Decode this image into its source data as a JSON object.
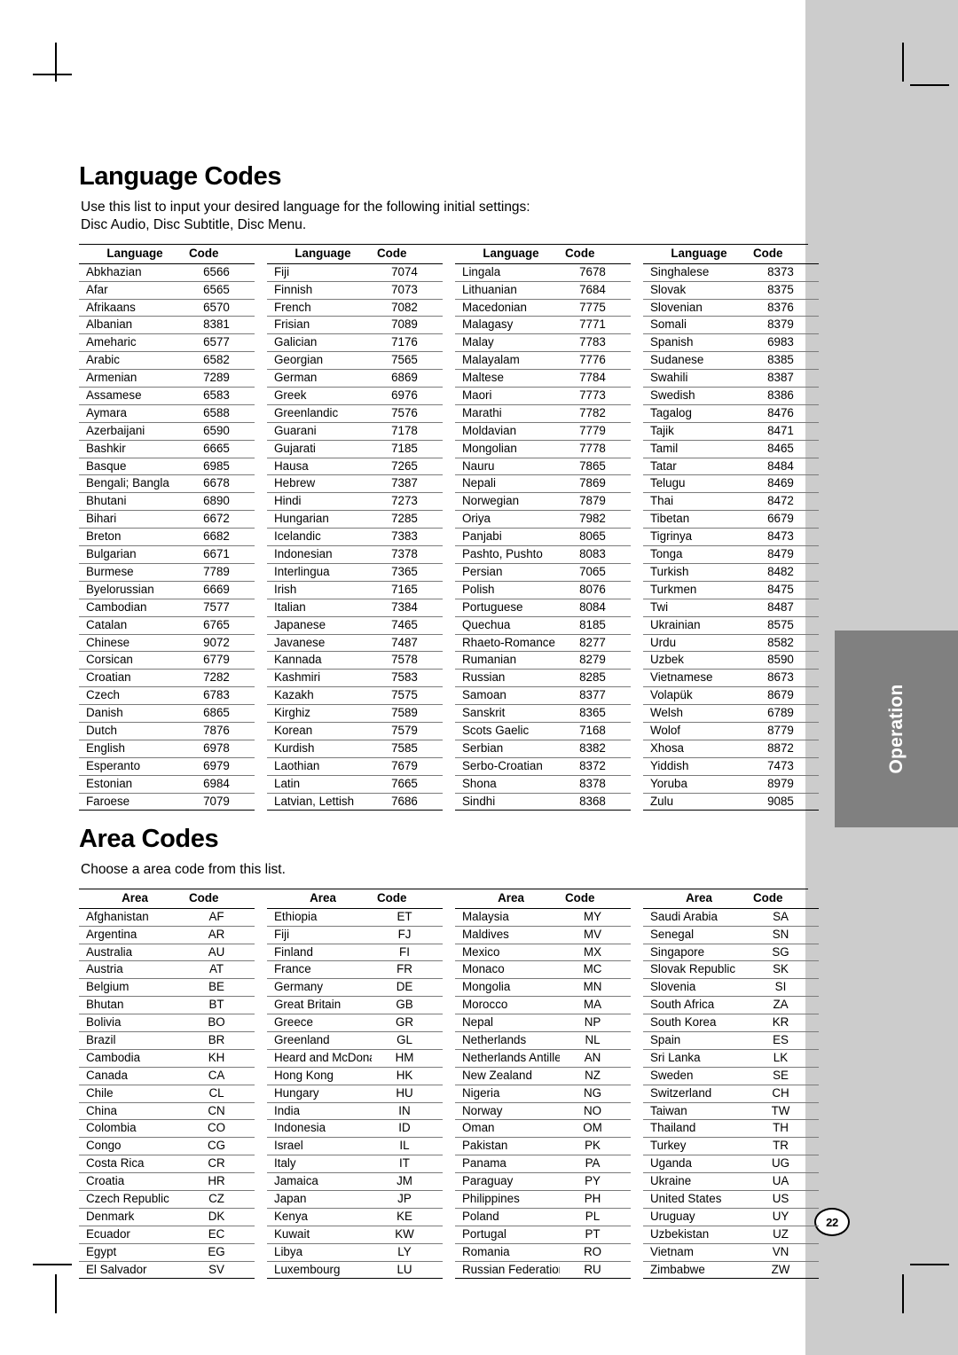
{
  "page": {
    "number": "22",
    "side_tab_label": "Operation"
  },
  "language_section": {
    "title": "Language Codes",
    "intro_line1": "Use this list to input your desired language for the following initial settings:",
    "intro_line2": "Disc Audio, Disc Subtitle, Disc Menu.",
    "headers": {
      "name": "Language",
      "code": "Code"
    },
    "columns": [
      [
        [
          "Abkhazian",
          "6566"
        ],
        [
          "Afar",
          "6565"
        ],
        [
          "Afrikaans",
          "6570"
        ],
        [
          "Albanian",
          "8381"
        ],
        [
          "Ameharic",
          "6577"
        ],
        [
          "Arabic",
          "6582"
        ],
        [
          "Armenian",
          "7289"
        ],
        [
          "Assamese",
          "6583"
        ],
        [
          "Aymara",
          "6588"
        ],
        [
          "Azerbaijani",
          "6590"
        ],
        [
          "Bashkir",
          "6665"
        ],
        [
          "Basque",
          "6985"
        ],
        [
          "Bengali; Bangla",
          "6678"
        ],
        [
          "Bhutani",
          "6890"
        ],
        [
          "Bihari",
          "6672"
        ],
        [
          "Breton",
          "6682"
        ],
        [
          "Bulgarian",
          "6671"
        ],
        [
          "Burmese",
          "7789"
        ],
        [
          "Byelorussian",
          "6669"
        ],
        [
          "Cambodian",
          "7577"
        ],
        [
          "Catalan",
          "6765"
        ],
        [
          "Chinese",
          "9072"
        ],
        [
          "Corsican",
          "6779"
        ],
        [
          "Croatian",
          "7282"
        ],
        [
          "Czech",
          "6783"
        ],
        [
          "Danish",
          "6865"
        ],
        [
          "Dutch",
          "7876"
        ],
        [
          "English",
          "6978"
        ],
        [
          "Esperanto",
          "6979"
        ],
        [
          "Estonian",
          "6984"
        ],
        [
          "Faroese",
          "7079"
        ]
      ],
      [
        [
          "Fiji",
          "7074"
        ],
        [
          "Finnish",
          "7073"
        ],
        [
          "French",
          "7082"
        ],
        [
          "Frisian",
          "7089"
        ],
        [
          "Galician",
          "7176"
        ],
        [
          "Georgian",
          "7565"
        ],
        [
          "German",
          "6869"
        ],
        [
          "Greek",
          "6976"
        ],
        [
          "Greenlandic",
          "7576"
        ],
        [
          "Guarani",
          "7178"
        ],
        [
          "Gujarati",
          "7185"
        ],
        [
          "Hausa",
          "7265"
        ],
        [
          "Hebrew",
          "7387"
        ],
        [
          "Hindi",
          "7273"
        ],
        [
          "Hungarian",
          "7285"
        ],
        [
          "Icelandic",
          "7383"
        ],
        [
          "Indonesian",
          "7378"
        ],
        [
          "Interlingua",
          "7365"
        ],
        [
          "Irish",
          "7165"
        ],
        [
          "Italian",
          "7384"
        ],
        [
          "Japanese",
          "7465"
        ],
        [
          "Javanese",
          "7487"
        ],
        [
          "Kannada",
          "7578"
        ],
        [
          "Kashmiri",
          "7583"
        ],
        [
          "Kazakh",
          "7575"
        ],
        [
          "Kirghiz",
          "7589"
        ],
        [
          "Korean",
          "7579"
        ],
        [
          "Kurdish",
          "7585"
        ],
        [
          "Laothian",
          "7679"
        ],
        [
          "Latin",
          "7665"
        ],
        [
          "Latvian, Lettish",
          "7686"
        ]
      ],
      [
        [
          "Lingala",
          "7678"
        ],
        [
          "Lithuanian",
          "7684"
        ],
        [
          "Macedonian",
          "7775"
        ],
        [
          "Malagasy",
          "7771"
        ],
        [
          "Malay",
          "7783"
        ],
        [
          "Malayalam",
          "7776"
        ],
        [
          "Maltese",
          "7784"
        ],
        [
          "Maori",
          "7773"
        ],
        [
          "Marathi",
          "7782"
        ],
        [
          "Moldavian",
          "7779"
        ],
        [
          "Mongolian",
          "7778"
        ],
        [
          "Nauru",
          "7865"
        ],
        [
          "Nepali",
          "7869"
        ],
        [
          "Norwegian",
          "7879"
        ],
        [
          "Oriya",
          "7982"
        ],
        [
          "Panjabi",
          "8065"
        ],
        [
          "Pashto, Pushto",
          "8083"
        ],
        [
          "Persian",
          "7065"
        ],
        [
          "Polish",
          "8076"
        ],
        [
          "Portuguese",
          "8084"
        ],
        [
          "Quechua",
          "8185"
        ],
        [
          "Rhaeto-Romance",
          "8277"
        ],
        [
          "Rumanian",
          "8279"
        ],
        [
          "Russian",
          "8285"
        ],
        [
          "Samoan",
          "8377"
        ],
        [
          "Sanskrit",
          "8365"
        ],
        [
          "Scots Gaelic",
          "7168"
        ],
        [
          "Serbian",
          "8382"
        ],
        [
          "Serbo-Croatian",
          "8372"
        ],
        [
          "Shona",
          "8378"
        ],
        [
          "Sindhi",
          "8368"
        ]
      ],
      [
        [
          "Singhalese",
          "8373"
        ],
        [
          "Slovak",
          "8375"
        ],
        [
          "Slovenian",
          "8376"
        ],
        [
          "Somali",
          "8379"
        ],
        [
          "Spanish",
          "6983"
        ],
        [
          "Sudanese",
          "8385"
        ],
        [
          "Swahili",
          "8387"
        ],
        [
          "Swedish",
          "8386"
        ],
        [
          "Tagalog",
          "8476"
        ],
        [
          "Tajik",
          "8471"
        ],
        [
          "Tamil",
          "8465"
        ],
        [
          "Tatar",
          "8484"
        ],
        [
          "Telugu",
          "8469"
        ],
        [
          "Thai",
          "8472"
        ],
        [
          "Tibetan",
          "6679"
        ],
        [
          "Tigrinya",
          "8473"
        ],
        [
          "Tonga",
          "8479"
        ],
        [
          "Turkish",
          "8482"
        ],
        [
          "Turkmen",
          "8475"
        ],
        [
          "Twi",
          "8487"
        ],
        [
          "Ukrainian",
          "8575"
        ],
        [
          "Urdu",
          "8582"
        ],
        [
          "Uzbek",
          "8590"
        ],
        [
          "Vietnamese",
          "8673"
        ],
        [
          "Volapük",
          "8679"
        ],
        [
          "Welsh",
          "6789"
        ],
        [
          "Wolof",
          "8779"
        ],
        [
          "Xhosa",
          "8872"
        ],
        [
          "Yiddish",
          "7473"
        ],
        [
          "Yoruba",
          "8979"
        ],
        [
          "Zulu",
          "9085"
        ]
      ]
    ]
  },
  "area_section": {
    "title": "Area Codes",
    "intro_line1": "Choose a area code from this list.",
    "headers": {
      "name": "Area",
      "code": "Code"
    },
    "columns": [
      [
        [
          "Afghanistan",
          "AF"
        ],
        [
          "Argentina",
          "AR"
        ],
        [
          "Australia",
          "AU"
        ],
        [
          "Austria",
          "AT"
        ],
        [
          "Belgium",
          "BE"
        ],
        [
          "Bhutan",
          "BT"
        ],
        [
          "Bolivia",
          "BO"
        ],
        [
          "Brazil",
          "BR"
        ],
        [
          "Cambodia",
          "KH"
        ],
        [
          "Canada",
          "CA"
        ],
        [
          "Chile",
          "CL"
        ],
        [
          "China",
          "CN"
        ],
        [
          "Colombia",
          "CO"
        ],
        [
          "Congo",
          "CG"
        ],
        [
          "Costa Rica",
          "CR"
        ],
        [
          "Croatia",
          "HR"
        ],
        [
          "Czech Republic",
          "CZ"
        ],
        [
          "Denmark",
          "DK"
        ],
        [
          "Ecuador",
          "EC"
        ],
        [
          "Egypt",
          "EG"
        ],
        [
          "El Salvador",
          "SV"
        ]
      ],
      [
        [
          "Ethiopia",
          "ET"
        ],
        [
          "Fiji",
          "FJ"
        ],
        [
          "Finland",
          "FI"
        ],
        [
          "France",
          "FR"
        ],
        [
          "Germany",
          "DE"
        ],
        [
          "Great Britain",
          "GB"
        ],
        [
          "Greece",
          "GR"
        ],
        [
          "Greenland",
          "GL"
        ],
        [
          "Heard and McDonald Islands",
          "HM"
        ],
        [
          "Hong Kong",
          "HK"
        ],
        [
          "Hungary",
          "HU"
        ],
        [
          "India",
          "IN"
        ],
        [
          "Indonesia",
          "ID"
        ],
        [
          "Israel",
          "IL"
        ],
        [
          "Italy",
          "IT"
        ],
        [
          "Jamaica",
          "JM"
        ],
        [
          "Japan",
          "JP"
        ],
        [
          "Kenya",
          "KE"
        ],
        [
          "Kuwait",
          "KW"
        ],
        [
          "Libya",
          "LY"
        ],
        [
          "Luxembourg",
          "LU"
        ]
      ],
      [
        [
          "Malaysia",
          "MY"
        ],
        [
          "Maldives",
          "MV"
        ],
        [
          "Mexico",
          "MX"
        ],
        [
          "Monaco",
          "MC"
        ],
        [
          "Mongolia",
          "MN"
        ],
        [
          "Morocco",
          "MA"
        ],
        [
          "Nepal",
          "NP"
        ],
        [
          "Netherlands",
          "NL"
        ],
        [
          "Netherlands Antilles",
          "AN"
        ],
        [
          "New Zealand",
          "NZ"
        ],
        [
          "Nigeria",
          "NG"
        ],
        [
          "Norway",
          "NO"
        ],
        [
          "Oman",
          "OM"
        ],
        [
          "Pakistan",
          "PK"
        ],
        [
          "Panama",
          "PA"
        ],
        [
          "Paraguay",
          "PY"
        ],
        [
          "Philippines",
          "PH"
        ],
        [
          "Poland",
          "PL"
        ],
        [
          "Portugal",
          "PT"
        ],
        [
          "Romania",
          "RO"
        ],
        [
          "Russian Federation",
          "RU"
        ]
      ],
      [
        [
          "Saudi Arabia",
          "SA"
        ],
        [
          "Senegal",
          "SN"
        ],
        [
          "Singapore",
          "SG"
        ],
        [
          "Slovak Republic",
          "SK"
        ],
        [
          "Slovenia",
          "SI"
        ],
        [
          "South Africa",
          "ZA"
        ],
        [
          "South Korea",
          "KR"
        ],
        [
          "Spain",
          "ES"
        ],
        [
          "Sri Lanka",
          "LK"
        ],
        [
          "Sweden",
          "SE"
        ],
        [
          "Switzerland",
          "CH"
        ],
        [
          "Taiwan",
          "TW"
        ],
        [
          "Thailand",
          "TH"
        ],
        [
          "Turkey",
          "TR"
        ],
        [
          "Uganda",
          "UG"
        ],
        [
          "Ukraine",
          "UA"
        ],
        [
          "United States",
          "US"
        ],
        [
          "Uruguay",
          "UY"
        ],
        [
          "Uzbekistan",
          "UZ"
        ],
        [
          "Vietnam",
          "VN"
        ],
        [
          "Zimbabwe",
          "ZW"
        ]
      ]
    ]
  }
}
